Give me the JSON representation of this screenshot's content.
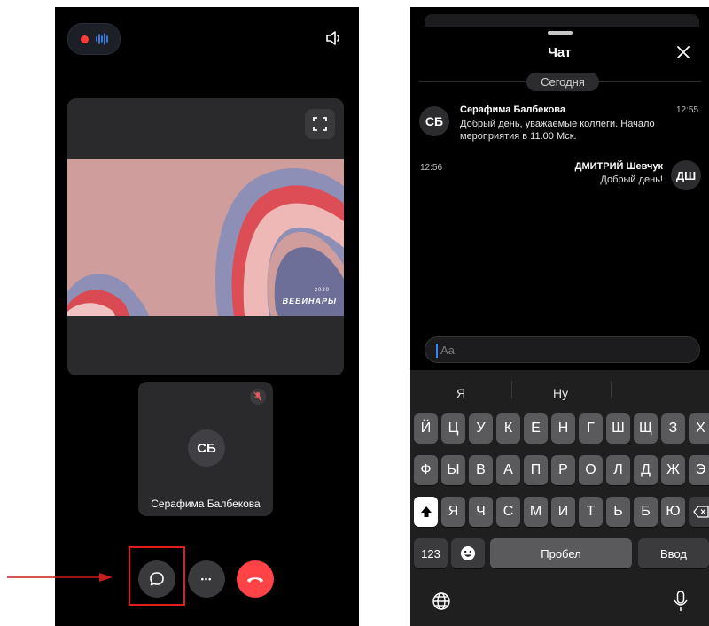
{
  "left_screen": {
    "slide": {
      "brand_text": "ВЕБИНАРЫ",
      "year_text": "2020"
    },
    "participant": {
      "initials": "СБ",
      "name": "Серафима Балбекова"
    },
    "controls": {
      "more_label": "•••"
    }
  },
  "right_screen": {
    "title": "Чат",
    "date_divider": "Сегодня",
    "messages": [
      {
        "initials": "СБ",
        "author": "Серафима Балбекова",
        "time": "12:55",
        "text": "Добрый день, уважаемые коллеги. Начало мероприятия в 11.00 Мск."
      },
      {
        "initials": "ДШ",
        "author": "ДМИТРИЙ Шевчук",
        "time": "12:56",
        "text": "Добрый день!"
      }
    ],
    "input": {
      "placeholder": "Aa"
    },
    "keyboard": {
      "suggestions": [
        "Я",
        "Ну",
        ""
      ],
      "row1": [
        "Й",
        "Ц",
        "У",
        "К",
        "Е",
        "Н",
        "Г",
        "Ш",
        "Щ",
        "З",
        "Х"
      ],
      "row2": [
        "Ф",
        "Ы",
        "В",
        "А",
        "П",
        "Р",
        "О",
        "Л",
        "Д",
        "Ж",
        "Э"
      ],
      "row3": [
        "Я",
        "Ч",
        "С",
        "М",
        "И",
        "Т",
        "Ь",
        "Б",
        "Ю"
      ],
      "numbers_label": "123",
      "space_label": "Пробел",
      "return_label": "Ввод"
    }
  },
  "colors": {
    "record_dot": "#ff3b3b",
    "hangup": "#ff4346",
    "annotation": "#e31b1b",
    "caret": "#3b82f6"
  },
  "icons": [
    "waveform-icon",
    "speaker-icon",
    "fullscreen-icon",
    "mic-off-icon",
    "chat-bubble-icon",
    "more-icon",
    "hangup-icon",
    "close-icon",
    "shift-icon",
    "backspace-icon",
    "emoji-icon",
    "globe-icon",
    "mic-icon"
  ]
}
